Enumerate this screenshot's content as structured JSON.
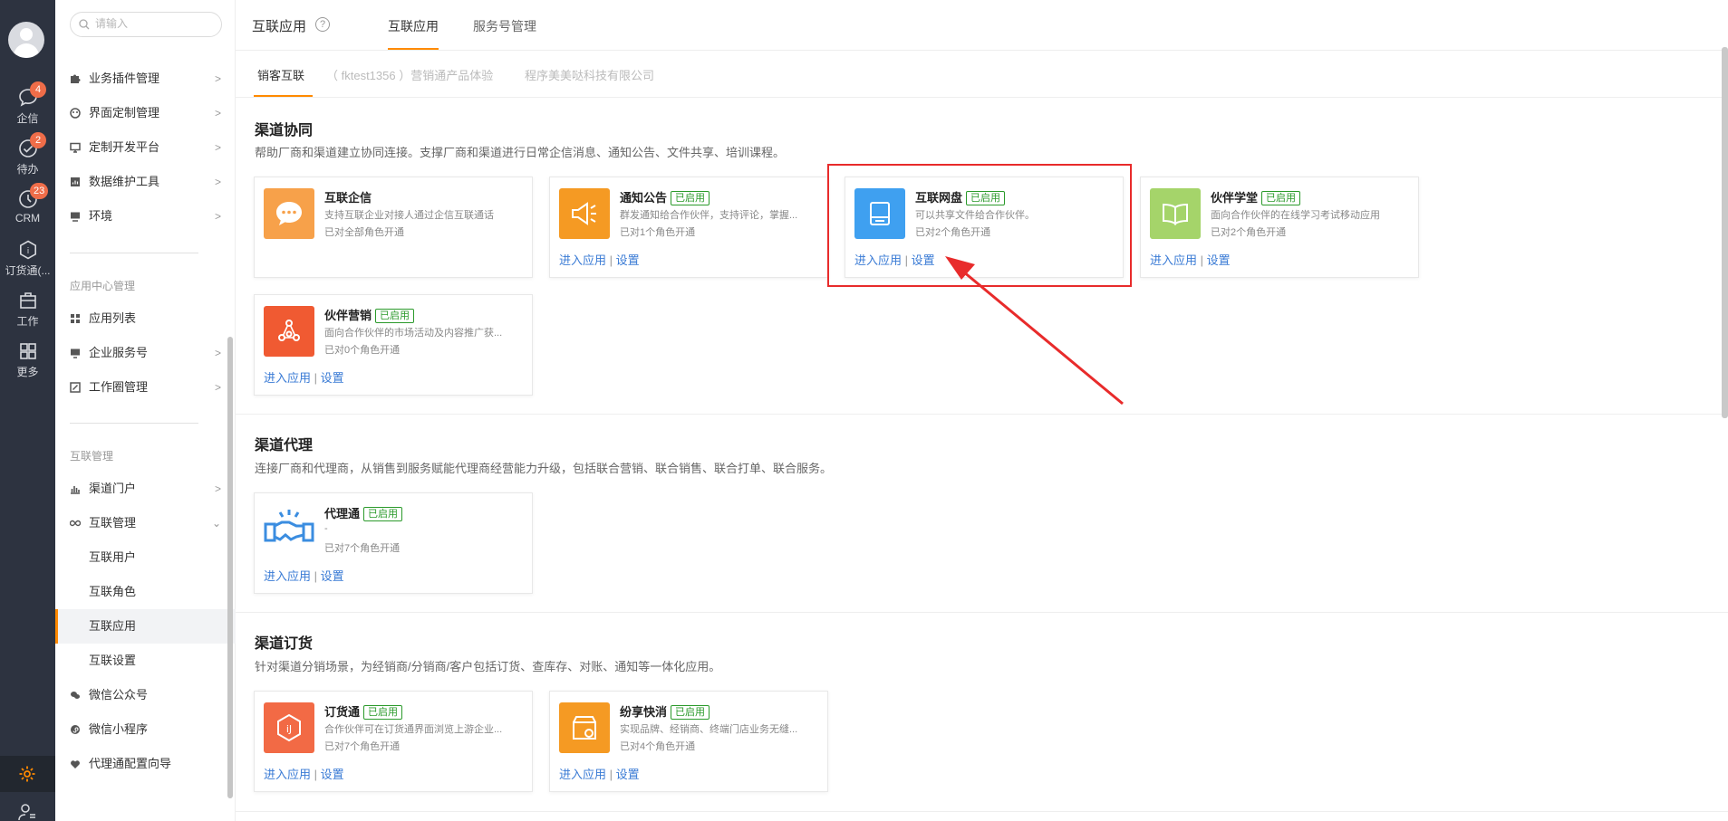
{
  "rail": {
    "items": [
      {
        "label": "企信",
        "badge": "4"
      },
      {
        "label": "待办",
        "badge": "2"
      },
      {
        "label": "CRM",
        "badge": "23"
      },
      {
        "label": "订货通(...",
        "badge": ""
      },
      {
        "label": "工作",
        "badge": ""
      },
      {
        "label": "更多",
        "badge": ""
      }
    ]
  },
  "sidebar": {
    "search_placeholder": "请输入",
    "items_top": [
      {
        "label": "业务插件管理"
      },
      {
        "label": "界面定制管理"
      },
      {
        "label": "定制开发平台"
      },
      {
        "label": "数据维护工具"
      },
      {
        "label": "环境"
      }
    ],
    "group_app": "应用中心管理",
    "items_app": [
      {
        "label": "应用列表"
      },
      {
        "label": "企业服务号"
      },
      {
        "label": "工作圈管理"
      }
    ],
    "group_interconnect": "互联管理",
    "items_interconnect": [
      {
        "label": "渠道门户"
      },
      {
        "label": "互联管理"
      },
      {
        "label": "互联用户"
      },
      {
        "label": "互联角色"
      },
      {
        "label": "互联应用"
      },
      {
        "label": "互联设置"
      },
      {
        "label": "微信公众号"
      },
      {
        "label": "微信小程序"
      },
      {
        "label": "代理通配置向导"
      }
    ]
  },
  "header": {
    "title": "互联应用",
    "help": "?",
    "tabs": [
      "互联应用",
      "服务号管理"
    ],
    "sub_tabs": [
      "销客互联",
      "（ fktest1356 ）营销通产品体验",
      "程序美美哒科技有限公司"
    ]
  },
  "sections": [
    {
      "title": "渠道协同",
      "desc": "帮助厂商和渠道建立协同连接。支撑厂商和渠道进行日常企信消息、通知公告、文件共享、培训课程。",
      "cards": [
        {
          "name": "互联企信",
          "tag": "",
          "desc": "支持互联企业对接人通过企信互联通话",
          "meta": "已对全部角色开通",
          "enter": "",
          "settings": ""
        },
        {
          "name": "通知公告",
          "tag": "已启用",
          "desc": "群发通知给合作伙伴，支持评论，掌握...",
          "meta": "已对1个角色开通",
          "enter": "进入应用",
          "settings": "设置"
        },
        {
          "name": "互联网盘",
          "tag": "已启用",
          "desc": "可以共享文件给合作伙伴。",
          "meta": "已对2个角色开通",
          "enter": "进入应用",
          "settings": "设置"
        },
        {
          "name": "伙伴学堂",
          "tag": "已启用",
          "desc": "面向合作伙伴的在线学习考试移动应用",
          "meta": "已对2个角色开通",
          "enter": "进入应用",
          "settings": "设置"
        },
        {
          "name": "伙伴营销",
          "tag": "已启用",
          "desc": "面向合作伙伴的市场活动及内容推广获...",
          "meta": "已对0个角色开通",
          "enter": "进入应用",
          "settings": "设置"
        }
      ]
    },
    {
      "title": "渠道代理",
      "desc": "连接厂商和代理商，从销售到服务赋能代理商经营能力升级，包括联合营销、联合销售、联合打单、联合服务。",
      "cards": [
        {
          "name": "代理通",
          "tag": "已启用",
          "desc": "-",
          "meta": "已对7个角色开通",
          "enter": "进入应用",
          "settings": "设置"
        }
      ]
    },
    {
      "title": "渠道订货",
      "desc": "针对渠道分销场景，为经销商/分销商/客户包括订货、查库存、对账、通知等一体化应用。",
      "cards": [
        {
          "name": "订货通",
          "tag": "已启用",
          "desc": "合作伙伴可在订货通界面浏览上游企业...",
          "meta": "已对7个角色开通",
          "enter": "进入应用",
          "settings": "设置"
        },
        {
          "name": "纷享快消",
          "tag": "已启用",
          "desc": "实现品牌、经销商、终端门店业务无缝...",
          "meta": "已对4个角色开通",
          "enter": "进入应用",
          "settings": "设置"
        }
      ]
    }
  ],
  "link_separator": "|",
  "colors": {
    "accent": "#ff8a00",
    "rail_bg": "#2d3340",
    "tag_green": "#2b9a2b",
    "link_blue": "#3a7bd5",
    "highlight_red": "#e82b2b"
  }
}
